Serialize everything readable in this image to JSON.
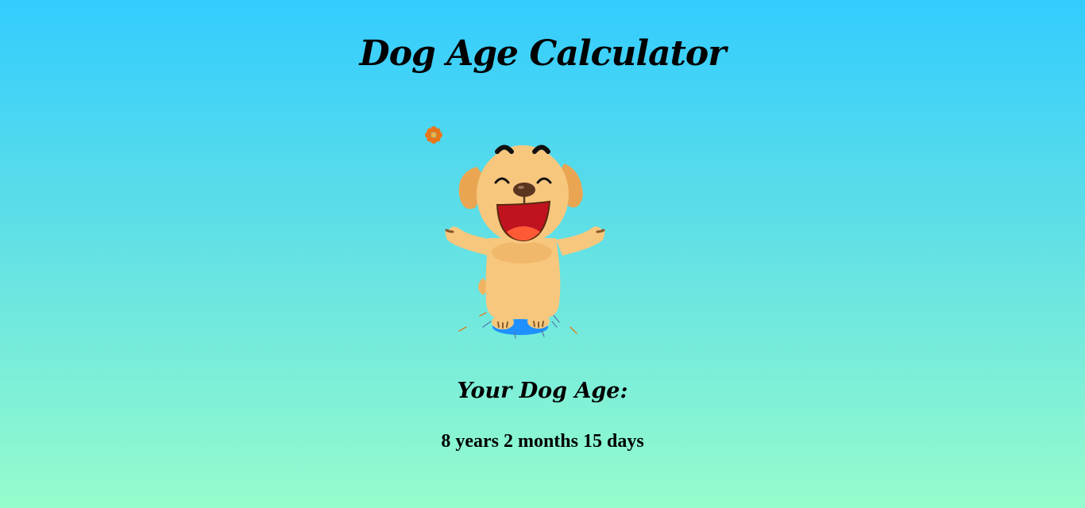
{
  "page": {
    "title": "Dog Age Calculator"
  },
  "illustration": {
    "icon": "happy-dog-icon",
    "flower_icon": "flower-icon"
  },
  "result": {
    "label": "Your Dog Age:",
    "value": "8 years 2 months 15 days"
  },
  "colors": {
    "background_top": "#33ccff",
    "background_bottom": "#96fccc",
    "dog_fur": "#f7c77e",
    "dog_shadow": "#e9a552",
    "mouth": "#c1121f",
    "tongue": "#ff5a36",
    "puddle": "#1e90ff"
  }
}
